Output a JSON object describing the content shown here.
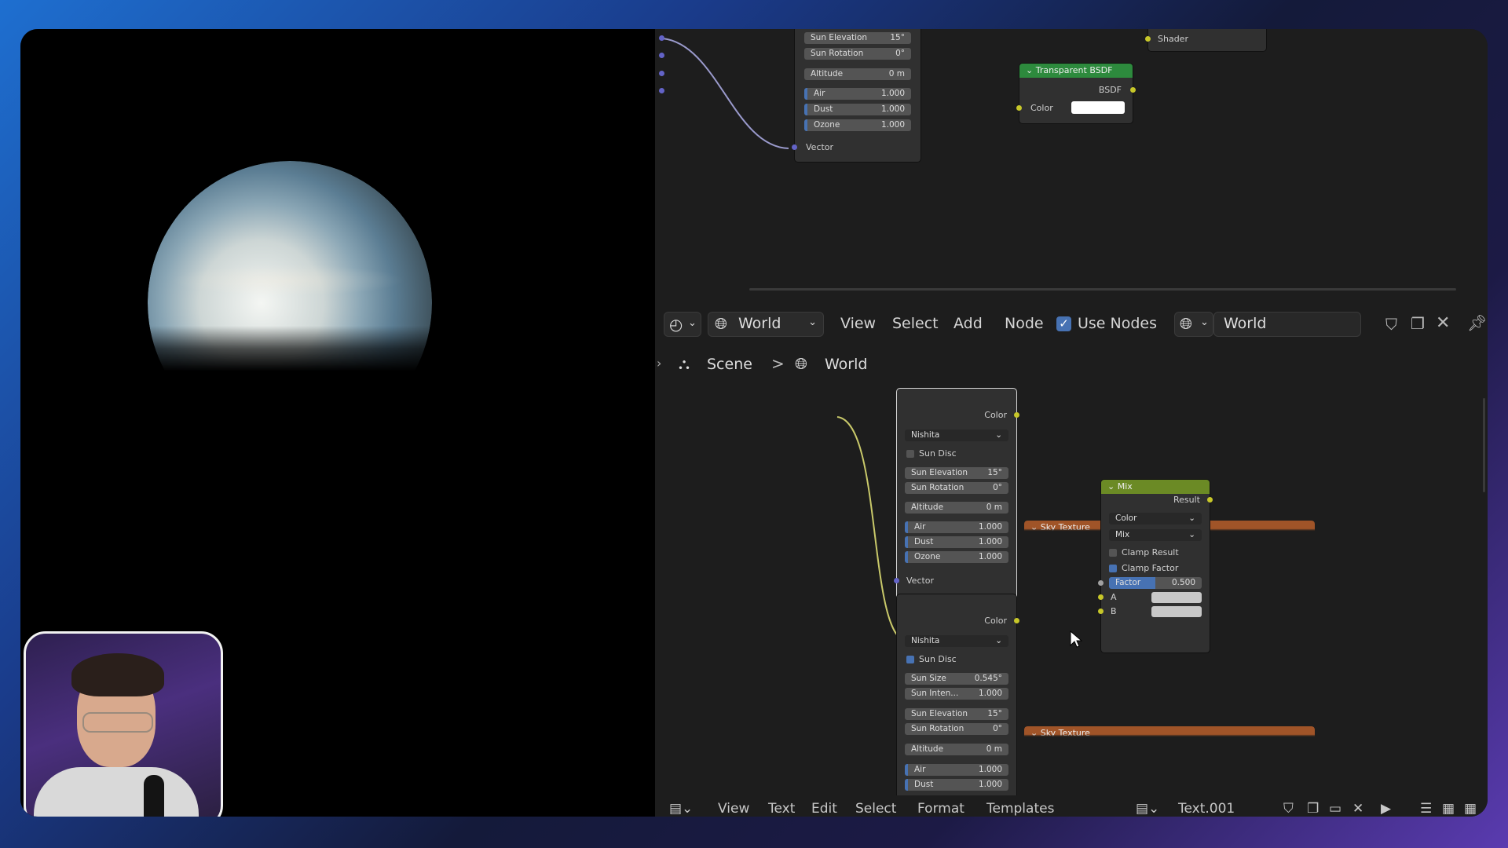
{
  "top_nodes": {
    "sky_partial": {
      "sun_elevation": {
        "label": "Sun Elevation",
        "value": "15°"
      },
      "sun_rotation": {
        "label": "Sun Rotation",
        "value": "0°"
      },
      "altitude": {
        "label": "Altitude",
        "value": "0 m"
      },
      "air": {
        "label": "Air",
        "value": "1.000"
      },
      "dust": {
        "label": "Dust",
        "value": "1.000"
      },
      "ozone": {
        "label": "Ozone",
        "value": "1.000"
      },
      "vector": "Vector"
    },
    "shader_output": "Shader",
    "transparent_bsdf": {
      "title": "Transparent BSDF",
      "bsdf": "BSDF",
      "color": "Color"
    }
  },
  "header": {
    "editor_type_icon": "node-editor-icon",
    "shader_type": "World",
    "menus": [
      "View",
      "Select",
      "Add",
      "Node"
    ],
    "use_nodes_label": "Use Nodes",
    "use_nodes_checked": true,
    "world_name": "World"
  },
  "breadcrumb": {
    "scene": "Scene",
    "separator": ">",
    "world": "World"
  },
  "sky1": {
    "title": "Sky Texture",
    "output": "Color",
    "type": "Nishita",
    "sun_disc": {
      "label": "Sun Disc",
      "checked": false
    },
    "sun_elevation": {
      "label": "Sun Elevation",
      "value": "15°"
    },
    "sun_rotation": {
      "label": "Sun Rotation",
      "value": "0°"
    },
    "altitude": {
      "label": "Altitude",
      "value": "0 m"
    },
    "air": {
      "label": "Air",
      "value": "1.000"
    },
    "dust": {
      "label": "Dust",
      "value": "1.000"
    },
    "ozone": {
      "label": "Ozone",
      "value": "1.000"
    },
    "vector": "Vector"
  },
  "sky2": {
    "title": "Sky Texture",
    "output": "Color",
    "type": "Nishita",
    "sun_disc": {
      "label": "Sun Disc",
      "checked": true
    },
    "sun_size": {
      "label": "Sun Size",
      "value": "0.545°"
    },
    "sun_intensity": {
      "label": "Sun Inten...",
      "value": "1.000"
    },
    "sun_elevation": {
      "label": "Sun Elevation",
      "value": "15°"
    },
    "sun_rotation": {
      "label": "Sun Rotation",
      "value": "0°"
    },
    "altitude": {
      "label": "Altitude",
      "value": "0 m"
    },
    "air": {
      "label": "Air",
      "value": "1.000"
    },
    "dust": {
      "label": "Dust",
      "value": "1.000"
    }
  },
  "mix": {
    "title": "Mix",
    "output": "Result",
    "data_type": "Color",
    "blend_type": "Mix",
    "clamp_result": {
      "label": "Clamp Result",
      "checked": false
    },
    "clamp_factor": {
      "label": "Clamp Factor",
      "checked": true
    },
    "factor": {
      "label": "Factor",
      "value": "0.500"
    },
    "a": "A",
    "b": "B"
  },
  "text_editor_bar": {
    "menus": [
      "View",
      "Text",
      "Edit",
      "Select",
      "Format",
      "Templates"
    ],
    "text_name": "Text.001"
  },
  "colors": {
    "sky_header": "#a05428",
    "shader_header": "#2d8a3d",
    "mix_header": "#6b8a25",
    "accent": "#4772b3"
  }
}
